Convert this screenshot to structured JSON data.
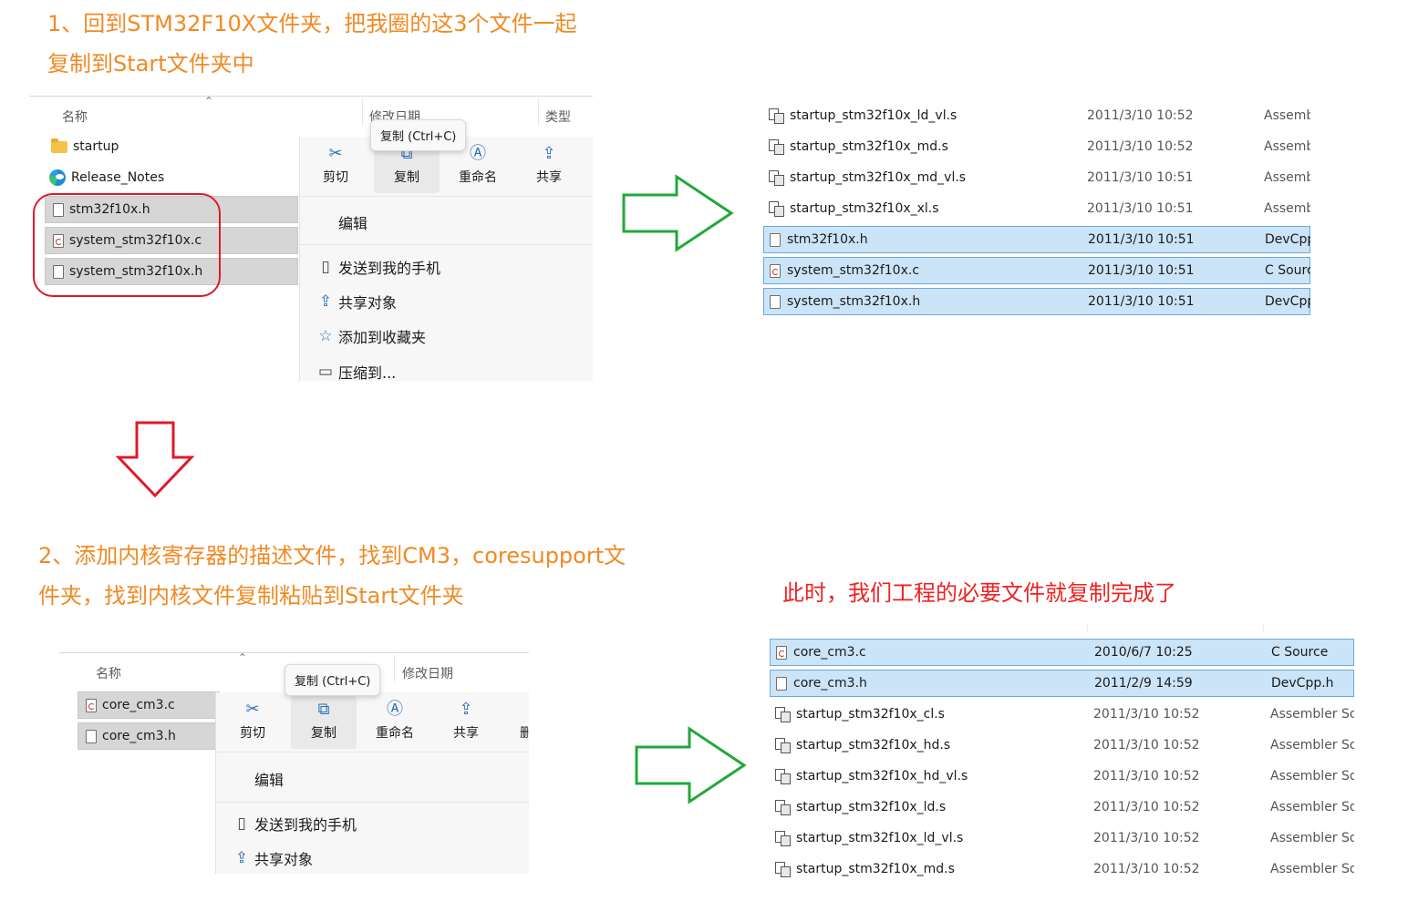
{
  "colors": {
    "step_title": "#f08a24",
    "conclusion": "#ee2222",
    "arrow_right": "#21a83a",
    "arrow_down": "#e0192a",
    "selection_blue": "#cce4f7"
  },
  "step1": {
    "title_line1": "1、回到STM32F10X文件夹，把我圈的这3个文件一起",
    "title_line2": "复制到Start文件夹中"
  },
  "step2": {
    "title_line1": "2、添加内核寄存器的描述文件，找到CM3，coresupport文",
    "title_line2": "件夹，找到内核文件复制粘贴到Start文件夹"
  },
  "conclusion": "此时，我们工程的必要文件就复制完成了",
  "explorer1": {
    "col_name": "名称",
    "col_date": "修改日期",
    "col_type": "类型",
    "files": [
      {
        "name": "startup",
        "icon": "folder-icon"
      },
      {
        "name": "Release_Notes",
        "icon": "edge-icon"
      },
      {
        "name": "stm32f10x.h",
        "icon": "file-icon"
      },
      {
        "name": "system_stm32f10x.c",
        "icon": "c-file-icon"
      },
      {
        "name": "system_stm32f10x.h",
        "icon": "file-icon"
      }
    ],
    "tooltip": "复制 (Ctrl+C)",
    "toolbar": [
      {
        "label": "剪切",
        "icon": "scissors-icon"
      },
      {
        "label": "复制",
        "icon": "copy-icon"
      },
      {
        "label": "重命名",
        "icon": "rename-icon"
      },
      {
        "label": "共享",
        "icon": "share-icon"
      }
    ],
    "menu": [
      {
        "label": "编辑",
        "icon": ""
      },
      {
        "label": "发送到我的手机",
        "icon": "phone-icon"
      },
      {
        "label": "共享对象",
        "icon": "share-icon"
      },
      {
        "label": "添加到收藏夹",
        "icon": "star-icon"
      },
      {
        "label": "压缩到...",
        "icon": "zip-icon"
      }
    ]
  },
  "explorer2": {
    "col_name": "名称",
    "col_date": "修改日期",
    "files": [
      {
        "name": "core_cm3.c",
        "icon": "c-file-icon"
      },
      {
        "name": "core_cm3.h",
        "icon": "file-icon"
      }
    ],
    "tooltip": "复制 (Ctrl+C)",
    "toolbar": [
      {
        "label": "剪切",
        "icon": "scissors-icon"
      },
      {
        "label": "复制",
        "icon": "copy-icon"
      },
      {
        "label": "重命名",
        "icon": "rename-icon"
      },
      {
        "label": "共享",
        "icon": "share-icon"
      },
      {
        "label": "删",
        "icon": ""
      }
    ],
    "menu": [
      {
        "label": "编辑",
        "icon": ""
      },
      {
        "label": "发送到我的手机",
        "icon": "phone-icon"
      },
      {
        "label": "共享对象",
        "icon": "share-icon"
      }
    ]
  },
  "result1": {
    "rows": [
      {
        "name": "startup_stm32f10x_ld_vl.s",
        "date": "2011/3/10 10:52",
        "type": "Assemb",
        "icon": "asm-file-icon",
        "selected": false
      },
      {
        "name": "startup_stm32f10x_md.s",
        "date": "2011/3/10 10:52",
        "type": "Assemb",
        "icon": "asm-file-icon",
        "selected": false
      },
      {
        "name": "startup_stm32f10x_md_vl.s",
        "date": "2011/3/10 10:51",
        "type": "Assemb",
        "icon": "asm-file-icon",
        "selected": false
      },
      {
        "name": "startup_stm32f10x_xl.s",
        "date": "2011/3/10 10:51",
        "type": "Assemb",
        "icon": "asm-file-icon",
        "selected": false
      },
      {
        "name": "stm32f10x.h",
        "date": "2011/3/10 10:51",
        "type": "DevCpp",
        "icon": "file-icon",
        "selected": true
      },
      {
        "name": "system_stm32f10x.c",
        "date": "2011/3/10 10:51",
        "type": "C Sourc",
        "icon": "c-file-icon",
        "selected": true
      },
      {
        "name": "system_stm32f10x.h",
        "date": "2011/3/10 10:51",
        "type": "DevCpp",
        "icon": "file-icon",
        "selected": true
      }
    ]
  },
  "result2": {
    "rows": [
      {
        "name": "core_cm3.c",
        "date": "2010/6/7 10:25",
        "type": "C Source",
        "icon": "c-file-icon",
        "selected": true
      },
      {
        "name": "core_cm3.h",
        "date": "2011/2/9 14:59",
        "type": "DevCpp.h",
        "icon": "file-icon",
        "selected": true
      },
      {
        "name": "startup_stm32f10x_cl.s",
        "date": "2011/3/10 10:52",
        "type": "Assembler So",
        "icon": "asm-file-icon",
        "selected": false
      },
      {
        "name": "startup_stm32f10x_hd.s",
        "date": "2011/3/10 10:52",
        "type": "Assembler So",
        "icon": "asm-file-icon",
        "selected": false
      },
      {
        "name": "startup_stm32f10x_hd_vl.s",
        "date": "2011/3/10 10:52",
        "type": "Assembler So",
        "icon": "asm-file-icon",
        "selected": false
      },
      {
        "name": "startup_stm32f10x_ld.s",
        "date": "2011/3/10 10:52",
        "type": "Assembler So",
        "icon": "asm-file-icon",
        "selected": false
      },
      {
        "name": "startup_stm32f10x_ld_vl.s",
        "date": "2011/3/10 10:52",
        "type": "Assembler So",
        "icon": "asm-file-icon",
        "selected": false
      },
      {
        "name": "startup_stm32f10x_md.s",
        "date": "2011/3/10 10:52",
        "type": "Assembler So",
        "icon": "asm-file-icon",
        "selected": false
      }
    ]
  }
}
